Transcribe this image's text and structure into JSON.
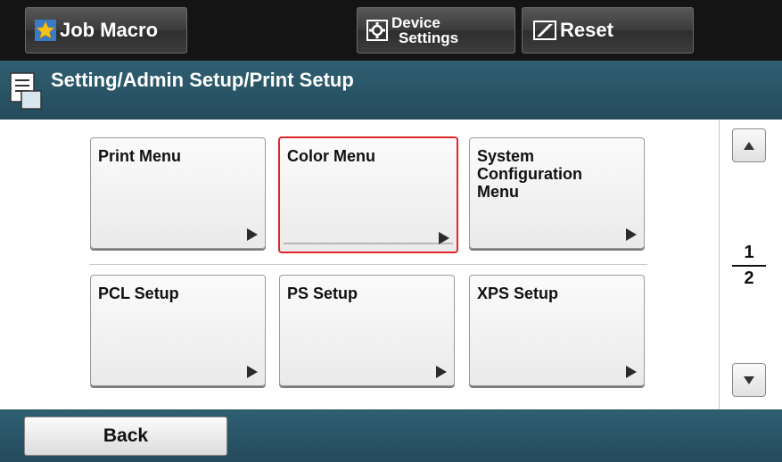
{
  "topbar": {
    "job_macro_label": "Job Macro",
    "device_settings_line1": "Device",
    "device_settings_line2": "Settings",
    "reset_label": "Reset"
  },
  "titlebar": {
    "breadcrumb": "Setting/Admin Setup/Print Setup"
  },
  "menu": {
    "items": [
      {
        "label": "Print Menu",
        "selected": false
      },
      {
        "label": "Color Menu",
        "selected": true
      },
      {
        "label": "System\nConfiguration\nMenu",
        "selected": false
      },
      {
        "label": "PCL Setup",
        "selected": false
      },
      {
        "label": "PS Setup",
        "selected": false
      },
      {
        "label": "XPS Setup",
        "selected": false
      }
    ]
  },
  "pagination": {
    "current_page": "1",
    "total_pages": "2"
  },
  "bottombar": {
    "back_label": "Back"
  },
  "colors": {
    "topbar_bg": "#141414",
    "titlebar_bg": "#2a5567",
    "selected_border": "#e0262b"
  },
  "icons": {
    "job_macro": "star-icon",
    "device_settings": "gear-icon",
    "reset": "reset-slash-icon",
    "title": "document-icon"
  }
}
